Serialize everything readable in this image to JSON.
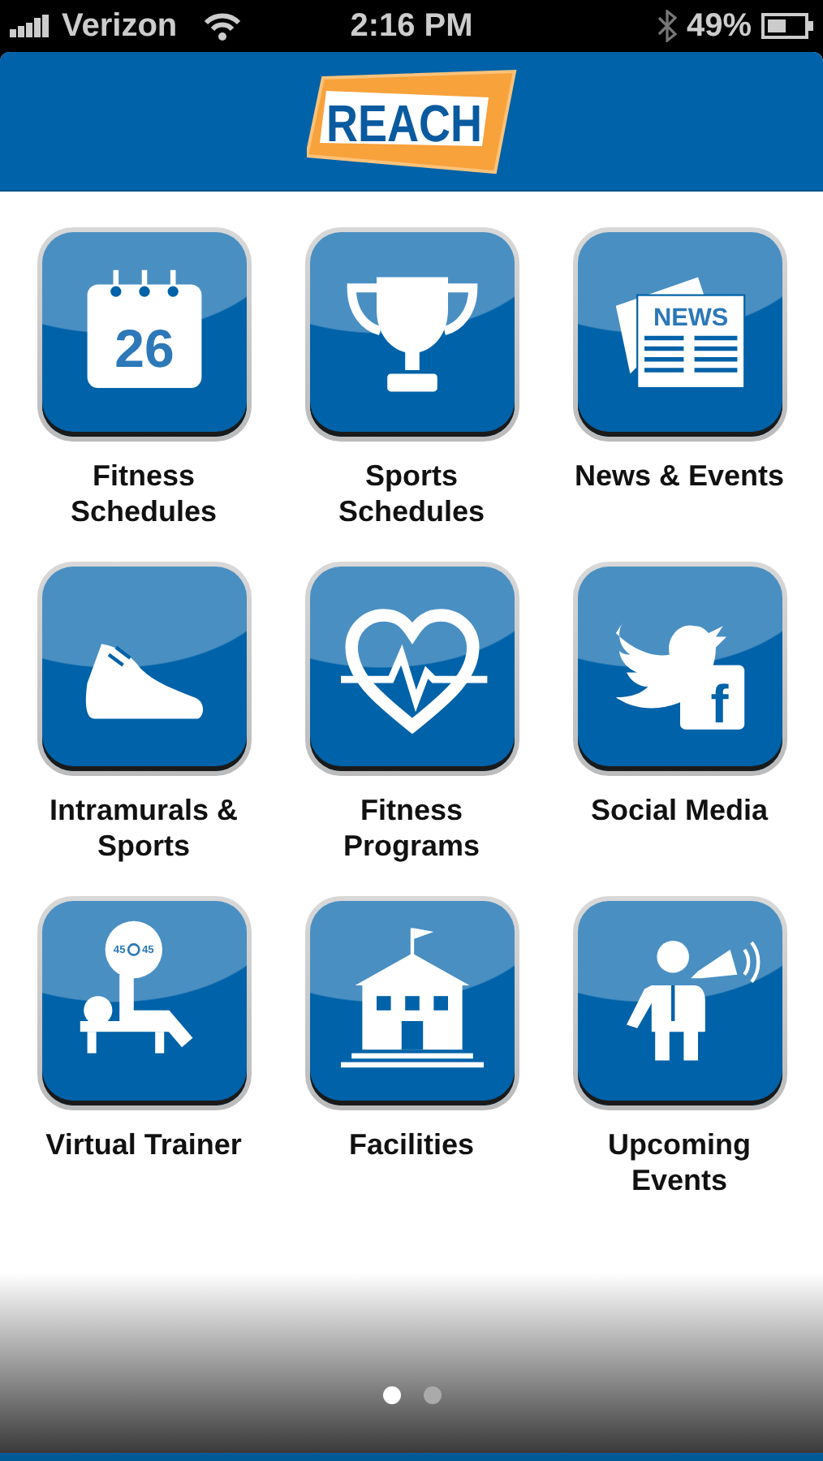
{
  "status_bar": {
    "carrier": "Verizon",
    "time": "2:16 PM",
    "battery": "49%"
  },
  "header": {
    "logo_text": "REACH"
  },
  "tiles": [
    {
      "kind": "calendar",
      "label": "Fitness\nSchedules",
      "icon_text": [
        "26"
      ]
    },
    {
      "kind": "trophy",
      "label": "Sports\nSchedules"
    },
    {
      "kind": "news",
      "label": "News & Events",
      "icon_text": [
        "NEWS"
      ]
    },
    {
      "kind": "shoe",
      "label": "Intramurals &\nSports"
    },
    {
      "kind": "heart",
      "label": "Fitness\nPrograms"
    },
    {
      "kind": "social",
      "label": "Social Media",
      "icon_text": [
        "f"
      ]
    },
    {
      "kind": "bench",
      "label": "Virtual Trainer",
      "icon_text": [
        "45",
        "45"
      ]
    },
    {
      "kind": "building",
      "label": "Facilities"
    },
    {
      "kind": "speaker",
      "label": "Upcoming\nEvents"
    }
  ],
  "pages": [
    {
      "selected": true
    },
    {
      "selected": false
    }
  ]
}
